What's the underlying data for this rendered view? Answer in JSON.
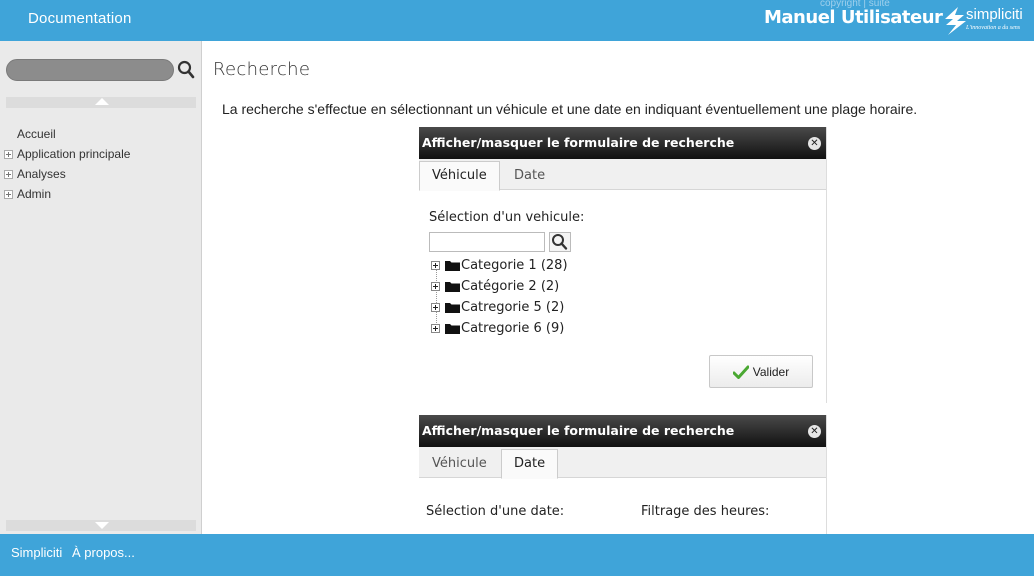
{
  "header": {
    "doc_title": "Documentation",
    "faint_text": "copyright | suite",
    "manual_title": "Manuel Utilisateur",
    "brand": "simpliciti",
    "tagline": "L'innovation a du sens"
  },
  "sidebar": {
    "search_placeholder": "",
    "items": [
      {
        "label": "Accueil",
        "expandable": false
      },
      {
        "label": "Application principale",
        "expandable": true
      },
      {
        "label": "Analyses",
        "expandable": true
      },
      {
        "label": "Admin",
        "expandable": true
      }
    ]
  },
  "main": {
    "title": "Recherche",
    "intro": "La recherche s'effectue en sélectionnant un véhicule et une date en indiquant éventuellement une plage horaire."
  },
  "panel1": {
    "bar_title": "Afficher/masquer le formulaire de recherche",
    "tabs": [
      "Véhicule",
      "Date"
    ],
    "active_tab": "Véhicule",
    "select_label": "Sélection d'un vehicule:",
    "tree": [
      "Categorie 1 (28)",
      "Catégorie 2 (2)",
      "Catregorie 5 (2)",
      "Catregorie 6 (9)"
    ],
    "submit_label": "Valider"
  },
  "panel2": {
    "bar_title": "Afficher/masquer le formulaire de recherche",
    "tabs": [
      "Véhicule",
      "Date"
    ],
    "active_tab": "Date",
    "date_label": "Sélection d'une date:",
    "hours_label": "Filtrage des heures:"
  },
  "footer": {
    "link1": "Simpliciti",
    "link2": "À propos..."
  },
  "colors": {
    "header_bg": "#3fa4d9",
    "footer_bg": "#3fa4d9",
    "sidebar_bg": "#eaeaea",
    "panel_bar": "#1a1a1a",
    "check_green": "#4aa832"
  }
}
